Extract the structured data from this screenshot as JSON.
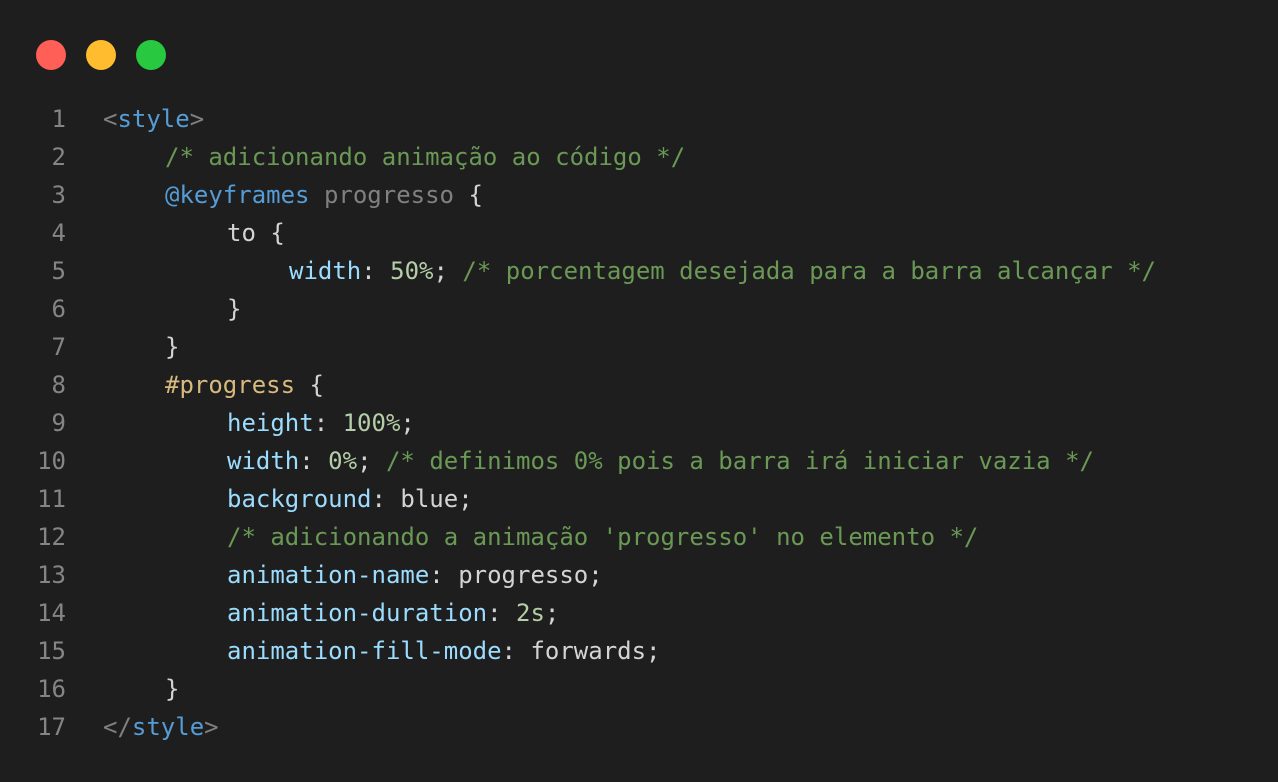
{
  "window": {
    "controls": [
      {
        "name": "close",
        "color": "#ff5f57"
      },
      {
        "name": "minimize",
        "color": "#febc2e"
      },
      {
        "name": "maximize",
        "color": "#28c840"
      }
    ]
  },
  "editor": {
    "lines": [
      {
        "number": "1",
        "indent": 0,
        "tokens": [
          {
            "t": "punct",
            "v": "<"
          },
          {
            "t": "tag",
            "v": "style"
          },
          {
            "t": "punct",
            "v": ">"
          }
        ]
      },
      {
        "number": "2",
        "indent": 1,
        "tokens": [
          {
            "t": "comment",
            "v": "/* adicionando animação ao código */"
          }
        ]
      },
      {
        "number": "3",
        "indent": 1,
        "tokens": [
          {
            "t": "at",
            "v": "@keyframes"
          },
          {
            "t": "text",
            "v": " "
          },
          {
            "t": "ident",
            "v": "progresso"
          },
          {
            "t": "text",
            "v": " {"
          }
        ]
      },
      {
        "number": "4",
        "indent": 2,
        "tokens": [
          {
            "t": "text",
            "v": "to {"
          }
        ]
      },
      {
        "number": "5",
        "indent": 3,
        "tokens": [
          {
            "t": "prop",
            "v": "width"
          },
          {
            "t": "text",
            "v": ": "
          },
          {
            "t": "num",
            "v": "50%"
          },
          {
            "t": "text",
            "v": "; "
          },
          {
            "t": "comment",
            "v": "/* porcentagem desejada para a barra alcançar */"
          }
        ]
      },
      {
        "number": "6",
        "indent": 2,
        "tokens": [
          {
            "t": "text",
            "v": "}"
          }
        ]
      },
      {
        "number": "7",
        "indent": 1,
        "tokens": [
          {
            "t": "text",
            "v": "}"
          }
        ]
      },
      {
        "number": "8",
        "indent": 1,
        "tokens": [
          {
            "t": "sel",
            "v": "#progress"
          },
          {
            "t": "text",
            "v": " {"
          }
        ]
      },
      {
        "number": "9",
        "indent": 2,
        "tokens": [
          {
            "t": "prop",
            "v": "height"
          },
          {
            "t": "text",
            "v": ": "
          },
          {
            "t": "num",
            "v": "100%"
          },
          {
            "t": "text",
            "v": ";"
          }
        ]
      },
      {
        "number": "10",
        "indent": 2,
        "tokens": [
          {
            "t": "prop",
            "v": "width"
          },
          {
            "t": "text",
            "v": ": "
          },
          {
            "t": "num",
            "v": "0%"
          },
          {
            "t": "text",
            "v": "; "
          },
          {
            "t": "comment",
            "v": "/* definimos 0% pois a barra irá iniciar vazia */"
          }
        ]
      },
      {
        "number": "11",
        "indent": 2,
        "tokens": [
          {
            "t": "prop",
            "v": "background"
          },
          {
            "t": "text",
            "v": ": blue;"
          }
        ]
      },
      {
        "number": "12",
        "indent": 2,
        "tokens": [
          {
            "t": "comment",
            "v": "/* adicionando a animação 'progresso' no elemento */"
          }
        ]
      },
      {
        "number": "13",
        "indent": 2,
        "tokens": [
          {
            "t": "prop",
            "v": "animation-name"
          },
          {
            "t": "text",
            "v": ": progresso;"
          }
        ]
      },
      {
        "number": "14",
        "indent": 2,
        "tokens": [
          {
            "t": "prop",
            "v": "animation-duration"
          },
          {
            "t": "text",
            "v": ": "
          },
          {
            "t": "num",
            "v": "2s"
          },
          {
            "t": "text",
            "v": ";"
          }
        ]
      },
      {
        "number": "15",
        "indent": 2,
        "tokens": [
          {
            "t": "prop",
            "v": "animation-fill-mode"
          },
          {
            "t": "text",
            "v": ": forwards;"
          }
        ]
      },
      {
        "number": "16",
        "indent": 1,
        "tokens": [
          {
            "t": "text",
            "v": "}"
          }
        ]
      },
      {
        "number": "17",
        "indent": 0,
        "tokens": [
          {
            "t": "punct",
            "v": "</"
          },
          {
            "t": "tag",
            "v": "style"
          },
          {
            "t": "punct",
            "v": ">"
          }
        ]
      }
    ]
  }
}
